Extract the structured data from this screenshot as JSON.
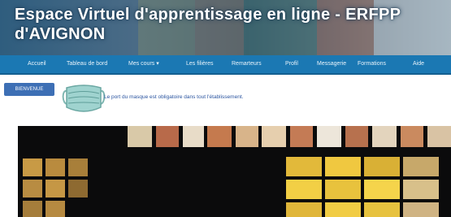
{
  "header": {
    "title": "Espace Virtuel d'apprentissage en ligne - ERFPP d'AVIGNON"
  },
  "nav": {
    "items": [
      {
        "label": "Accueil"
      },
      {
        "label": "Tableau de bord"
      },
      {
        "label": "Mes cours ▾"
      },
      {
        "label": "Les filières"
      },
      {
        "label": "Remarteurs"
      },
      {
        "label": "Profil"
      },
      {
        "label": "Messagerie"
      },
      {
        "label": "Formations"
      },
      {
        "label": "Aide"
      }
    ]
  },
  "notice": {
    "button_label": "BIENVENUE",
    "text": "Le port du masque est obligatoire dans tout l'établissement."
  },
  "colors": {
    "nav_bg": "#1b78b3",
    "notice_text": "#2b55a0",
    "button_bg": "#3d6fb5"
  },
  "icons": {
    "notice_icon": "face-mask-icon"
  }
}
